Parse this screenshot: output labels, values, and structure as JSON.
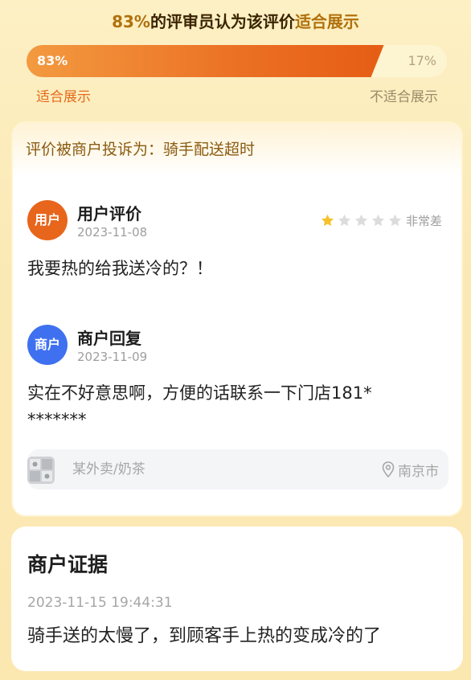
{
  "summary": {
    "percent_text": "83%",
    "middle_text": "的评审员认为该评价",
    "verdict_text": "适合展示"
  },
  "vote": {
    "approve_pct_label": "83%",
    "reject_pct_label": "17%",
    "approve_fraction": 0.83,
    "approve_label": "适合展示",
    "reject_label": "不适合展示"
  },
  "review_card": {
    "complaint_text": "评价被商户投诉为：骑手配送超时",
    "user_review": {
      "avatar_text": "用户",
      "title": "用户评价",
      "date": "2023-11-08",
      "rating": 1,
      "rating_max": 5,
      "rating_text": "非常差",
      "content": "我要热的给我送冷的？！"
    },
    "merchant_reply": {
      "avatar_text": "商户",
      "title": "商户回复",
      "date": "2023-11-09",
      "content_line1": "实在不好意思啊，方便的话联系一下门店181*",
      "content_line2": "*******"
    },
    "store": {
      "name": "某外卖/奶茶",
      "location": "南京市"
    }
  },
  "evidence_card": {
    "title": "商户证据",
    "timestamp": "2023-11-15 19:44:31",
    "content": "骑手送的太慢了，到顾客手上热的变成冷的了"
  },
  "colors": {
    "accent_orange": "#e8651c",
    "merchant_blue": "#3f70f0",
    "star_gold": "#f5c12c",
    "star_gray": "#dcdcdc"
  }
}
